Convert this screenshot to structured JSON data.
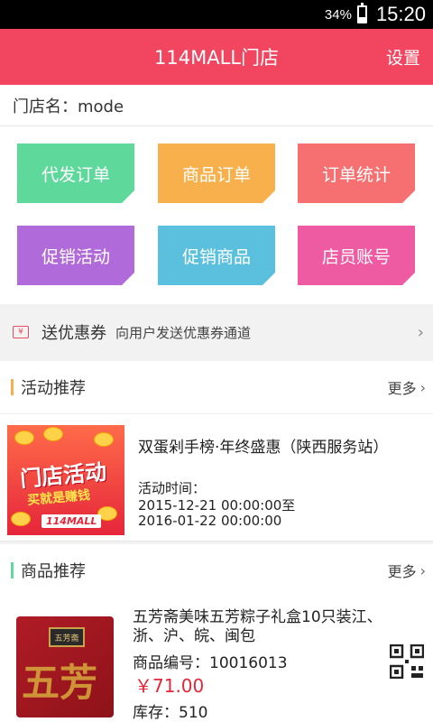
{
  "status_bar": {
    "battery": "34%",
    "time": "15:20"
  },
  "header": {
    "title": "114MALL门店",
    "settings": "设置"
  },
  "store": {
    "label": "门店名：mode"
  },
  "tiles": [
    {
      "label": "代发订单",
      "color": "#5ed99b"
    },
    {
      "label": "商品订单",
      "color": "#f7b04b"
    },
    {
      "label": "订单统计",
      "color": "#f77071"
    },
    {
      "label": "促销活动",
      "color": "#b06ad9"
    },
    {
      "label": "促销商品",
      "color": "#5bc0dd"
    },
    {
      "label": "店员账号",
      "color": "#ee5ba3"
    }
  ],
  "coupon": {
    "title": "送优惠券",
    "desc": "向用户发送优惠券通道"
  },
  "activity_section": {
    "title": "活动推荐",
    "more": "更多",
    "accent": "#f7b04b"
  },
  "activity": {
    "image_text": "门店活动",
    "image_sub": "买就是赚钱",
    "image_brand": "114MALL",
    "title": "双蛋剁手榜·年终盛惠（陕西服务站）",
    "time_label": "活动时间：",
    "time_start": "2015-12-21 00:00:00至",
    "time_end": "2016-01-22 00:00:00"
  },
  "product_section": {
    "title": "商品推荐",
    "more": "更多",
    "accent": "#5ed99b"
  },
  "product": {
    "image_text": "五芳",
    "image_label": "五芳斋",
    "name": "五芳斋美味五芳粽子礼盒10只装江、浙、沪、皖、闽包",
    "code": "商品编号：10016013",
    "price": "￥71.00",
    "stock": "库存：510"
  }
}
